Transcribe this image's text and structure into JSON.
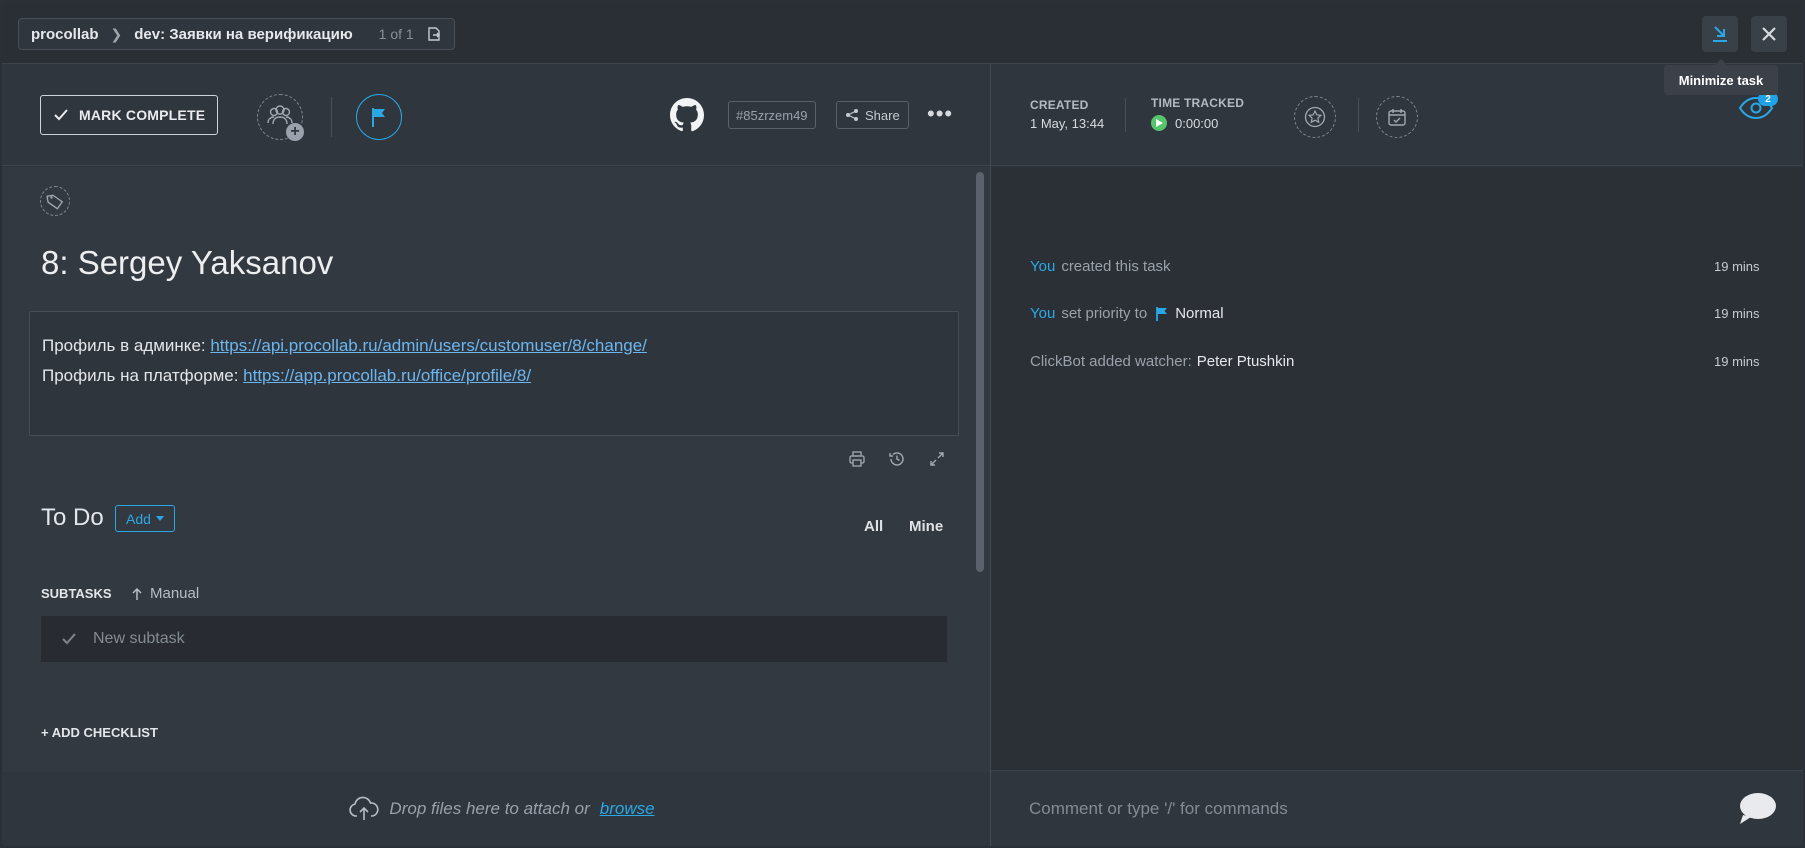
{
  "breadcrumb": {
    "workspace": "procollab",
    "list": "dev: Заявки на верификацию",
    "count": "1 of 1"
  },
  "tooltip": "Minimize task",
  "toolbar": {
    "mark_complete": "MARK COMPLETE",
    "task_id": "#85zrzem49",
    "share": "Share",
    "more": "•••"
  },
  "meta": {
    "created_label": "CREATED",
    "created_value": "1 May, 13:44",
    "time_tracked_label": "TIME TRACKED",
    "time_tracked_value": "0:00:00",
    "watchers_count": "2"
  },
  "task": {
    "title": "8: Sergey Yaksanov",
    "desc_line1_label": "Профиль в админке: ",
    "desc_line1_link": "https://api.procollab.ru/admin/users/customuser/8/change/",
    "desc_line2_label": "Профиль на платформе: ",
    "desc_line2_link": "https://app.procollab.ru/office/profile/8/"
  },
  "todo": {
    "heading": "To Do",
    "add": "Add",
    "filter_all": "All",
    "filter_mine": "Mine",
    "subtasks_label": "SUBTASKS",
    "sort_label": "Manual",
    "new_subtask_placeholder": "New subtask",
    "add_checklist": "+ ADD CHECKLIST"
  },
  "dropzone": {
    "text": "Drop files here to attach or",
    "browse": "browse"
  },
  "activity": [
    {
      "actor": "You",
      "text": "created this task",
      "time": "19 mins"
    },
    {
      "actor": "You",
      "text": "set priority to",
      "value": "Normal",
      "time": "19 mins"
    },
    {
      "actor": "",
      "text": "ClickBot added watcher:",
      "value": "Peter Ptushkin",
      "time": "19 mins"
    }
  ],
  "comment": {
    "placeholder": "Comment or type '/' for commands"
  },
  "colors": {
    "accent": "#2aa8e6",
    "background": "#2f353d",
    "play": "#56c46a"
  }
}
